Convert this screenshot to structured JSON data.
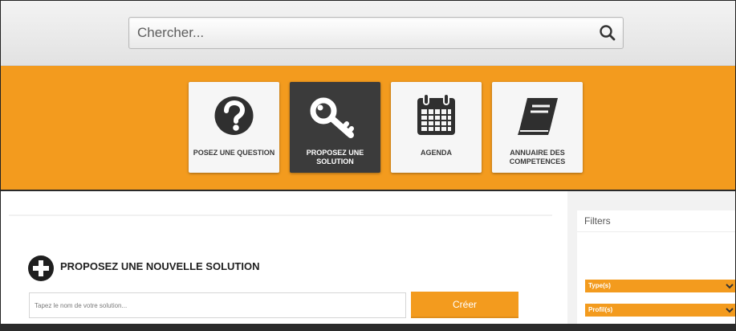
{
  "search": {
    "placeholder": "Chercher..."
  },
  "nav": {
    "tiles": [
      {
        "label": "POSEZ UNE QUESTION",
        "icon": "question-circle-icon"
      },
      {
        "label": "PROPOSEZ UNE SOLUTION",
        "icon": "key-icon",
        "active": true
      },
      {
        "label": "AGENDA",
        "icon": "calendar-icon"
      },
      {
        "label": "ANNUAIRE DES COMPETENCES",
        "icon": "book-icon"
      }
    ]
  },
  "colors": {
    "accent": "#f39b1e",
    "active_tile": "#3b3b3b",
    "dark": "#2b2b2b"
  },
  "main": {
    "title": "PROPOSEZ UNE NOUVELLE SOLUTION",
    "input_placeholder": "Tapez le nom de votre solution...",
    "create_label": "Créer"
  },
  "sidebar": {
    "filters_title": "Filters",
    "facets": [
      {
        "label": "Type(s)"
      },
      {
        "label": "Profil(s)"
      }
    ]
  }
}
